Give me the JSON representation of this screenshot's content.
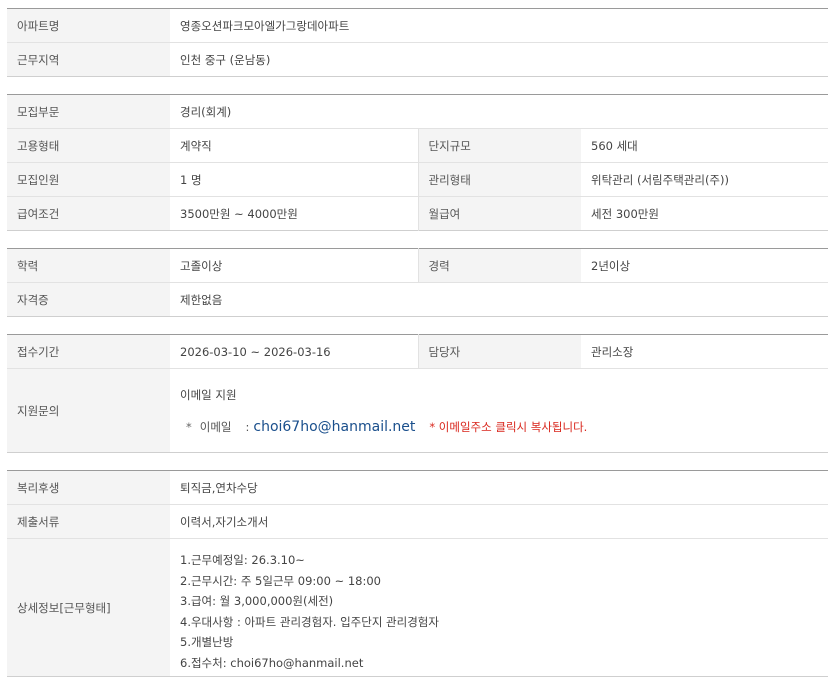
{
  "s1": {
    "apt_label": "아파트명",
    "apt_value": "영종오션파크모아엘가그랑데아파트",
    "region_label": "근무지역",
    "region_value": "인천 중구 (운남동)"
  },
  "s2": {
    "category_label": "모집부문",
    "category_value": "경리(회계)",
    "employment_label": "고용형태",
    "employment_value": "계약직",
    "complex_label": "단지규모",
    "complex_value": "560 세대",
    "headcount_label": "모집인원",
    "headcount_value": "1 명",
    "mgmt_label": "관리형태",
    "mgmt_value": "위탁관리 (서림주택관리(주))",
    "salary_label": "급여조건",
    "salary_value": "3500만원 ~ 4000만원",
    "monthly_label": "월급여",
    "monthly_value": "세전 300만원"
  },
  "s3": {
    "edu_label": "학력",
    "edu_value": "고졸이상",
    "exp_label": "경력",
    "exp_value": "2년이상",
    "cert_label": "자격증",
    "cert_value": "제한없음"
  },
  "s4": {
    "period_label": "접수기간",
    "period_value": "2026-03-10 ~ 2026-03-16",
    "manager_label": "담당자",
    "manager_value": "관리소장",
    "inquiry_label": "지원문의",
    "inquiry_value": "이메일 지원",
    "bullet": "*",
    "email_label": "이메일",
    "email_colon": ":",
    "email_value": "choi67ho@hanmail.net",
    "copy_note": "* 이메일주소 클릭시 복사됩니다."
  },
  "s5": {
    "welfare_label": "복리후생",
    "welfare_value": "퇴직금,연차수당",
    "docs_label": "제출서류",
    "docs_value": "이력서,자기소개서",
    "details_label": "상세정보[근무형태]",
    "details": [
      "1.근무예정일: 26.3.10~",
      "2.근무시간: 주 5일근무 09:00 ~ 18:00",
      "3.급여: 월 3,000,000원(세전)",
      "4.우대사항 : 아파트 관리경험자. 입주단지 관리경험자",
      "5.개별난방",
      "6.접수처: choi67ho@hanmail.net"
    ]
  }
}
